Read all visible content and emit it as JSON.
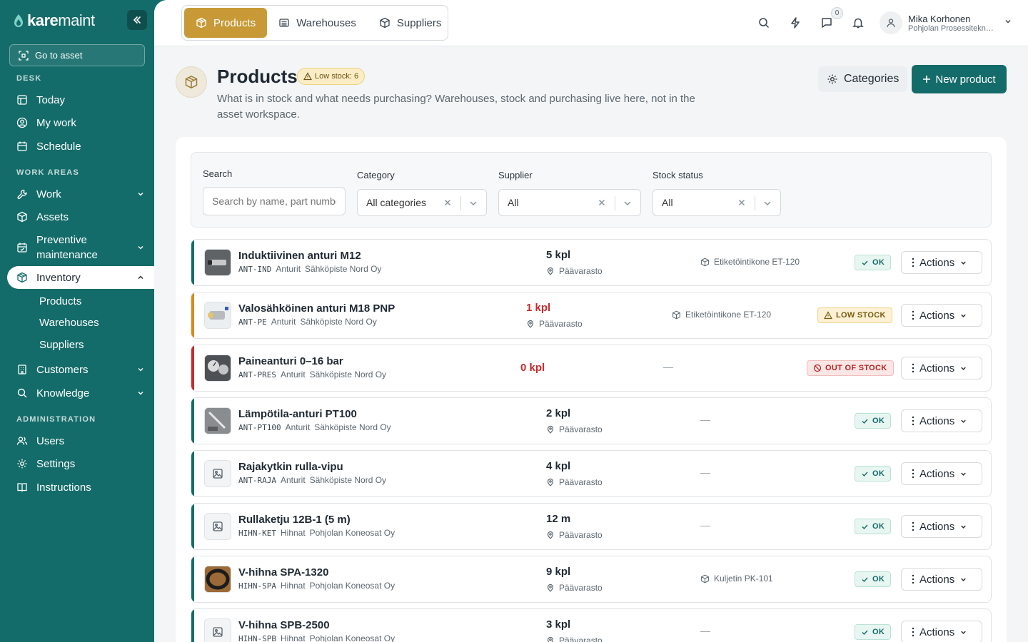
{
  "app": {
    "logo_bold": "kare",
    "logo_light": "maint"
  },
  "sidebar": {
    "goto_asset": "Go to asset",
    "sections": {
      "desk": "DESK",
      "work_areas": "WORK AREAS",
      "administration": "ADMINISTRATION"
    },
    "items": {
      "today": "Today",
      "my_work": "My work",
      "schedule": "Schedule",
      "work": "Work",
      "assets": "Assets",
      "preventive_1": "Preventive",
      "preventive_2": "maintenance",
      "inventory": "Inventory",
      "customers": "Customers",
      "knowledge": "Knowledge",
      "users": "Users",
      "settings": "Settings",
      "instructions": "Instructions"
    },
    "inventory_sub": {
      "products": "Products",
      "warehouses": "Warehouses",
      "suppliers": "Suppliers"
    }
  },
  "topbar": {
    "tabs": {
      "products": "Products",
      "warehouses": "Warehouses",
      "suppliers": "Suppliers"
    },
    "messages_count": "0",
    "user": {
      "name": "Mika Korhonen",
      "org": "Pohjolan Prosessitekniikka Oy"
    }
  },
  "header": {
    "title": "Products",
    "low_stock_badge": "Low stock: 6",
    "description": "What is in stock and what needs purchasing? Warehouses, stock and purchasing live here, not in the asset workspace.",
    "categories_button": "Categories",
    "new_product_button": "New product"
  },
  "filters": {
    "search_label": "Search",
    "search_placeholder": "Search by name, part number",
    "category_label": "Category",
    "category_value": "All categories",
    "supplier_label": "Supplier",
    "supplier_value": "All",
    "stock_label": "Stock status",
    "stock_value": "All"
  },
  "colors": {
    "brand": "#146c6a",
    "accent": "#c79a37",
    "ok": "#146c6a",
    "low": "#d98a1a",
    "out": "#c62b2b"
  },
  "products": [
    {
      "name": "Induktiivinen anturi M12",
      "code": "ANT-IND",
      "category": "Anturit",
      "supplier": "Sähköpiste Nord Oy",
      "qty": "5 kpl",
      "location": "Päävarasto",
      "asset": "Etiketöintikone ET-120",
      "status": "OK"
    },
    {
      "name": "Valosähköinen anturi M18 PNP",
      "code": "ANT-PE",
      "category": "Anturit",
      "supplier": "Sähköpiste Nord Oy",
      "qty": "1 kpl",
      "location": "Päävarasto",
      "asset": "Etiketöintikone ET-120",
      "status": "LOW STOCK"
    },
    {
      "name": "Paineanturi 0–16 bar",
      "code": "ANT-PRES",
      "category": "Anturit",
      "supplier": "Sähköpiste Nord Oy",
      "qty": "0 kpl",
      "location": "",
      "asset": "—",
      "status": "OUT OF STOCK"
    },
    {
      "name": "Lämpötila-anturi PT100",
      "code": "ANT-PT100",
      "category": "Anturit",
      "supplier": "Sähköpiste Nord Oy",
      "qty": "2 kpl",
      "location": "Päävarasto",
      "asset": "—",
      "status": "OK"
    },
    {
      "name": "Rajakytkin rulla-vipu",
      "code": "ANT-RAJA",
      "category": "Anturit",
      "supplier": "Sähköpiste Nord Oy",
      "qty": "4 kpl",
      "location": "Päävarasto",
      "asset": "—",
      "status": "OK"
    },
    {
      "name": "Rullaketju 12B-1 (5 m)",
      "code": "HIHN-KET",
      "category": "Hihnat",
      "supplier": "Pohjolan Koneosat Oy",
      "qty": "12 m",
      "location": "Päävarasto",
      "asset": "—",
      "status": "OK"
    },
    {
      "name": "V-hihna SPA-1320",
      "code": "HIHN-SPA",
      "category": "Hihnat",
      "supplier": "Pohjolan Koneosat Oy",
      "qty": "9 kpl",
      "location": "Päävarasto",
      "asset": "Kuljetin PK-101",
      "status": "OK"
    },
    {
      "name": "V-hihna SPB-2500",
      "code": "HIHN-SPB",
      "category": "Hihnat",
      "supplier": "Pohjolan Koneosat Oy",
      "qty": "3 kpl",
      "location": "Päävarasto",
      "asset": "—",
      "status": "OK"
    }
  ],
  "row_actions_label": "Actions"
}
